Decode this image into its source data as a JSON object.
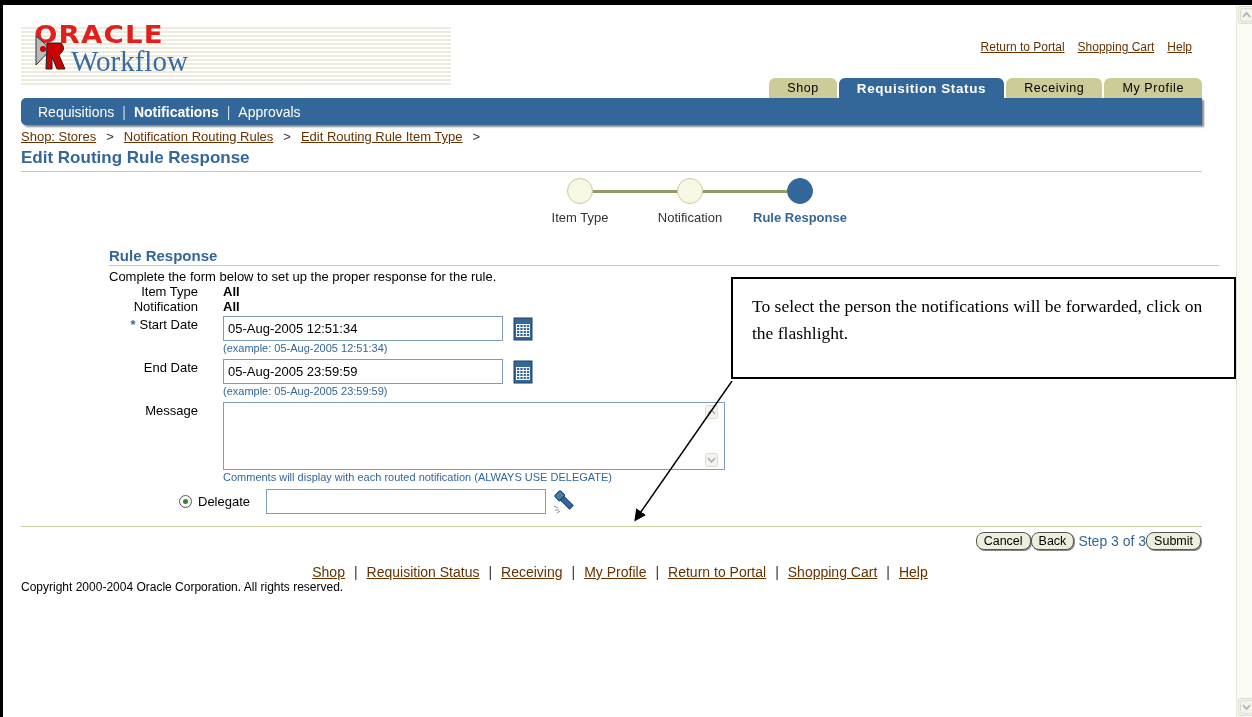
{
  "logo": {
    "brand": "ORACLE",
    "product": "Workflow"
  },
  "global_links": [
    "Return to Portal",
    "Shopping Cart",
    "Help"
  ],
  "tabs": [
    {
      "label": "Shop",
      "selected": false
    },
    {
      "label": "Requisition Status",
      "selected": true
    },
    {
      "label": "Receiving",
      "selected": false
    },
    {
      "label": "My Profile",
      "selected": false
    }
  ],
  "subtabs": [
    {
      "label": "Requisitions",
      "selected": false
    },
    {
      "label": "Notifications",
      "selected": true
    },
    {
      "label": "Approvals",
      "selected": false
    }
  ],
  "breadcrumbs": [
    "Shop: Stores",
    "Notification Routing Rules",
    "Edit Routing Rule Item Type"
  ],
  "breadcrumb_separator": ">",
  "page_title": "Edit Routing Rule Response",
  "train": [
    {
      "label": "Item Type",
      "selected": false
    },
    {
      "label": "Notification",
      "selected": false
    },
    {
      "label": "Rule Response",
      "selected": true
    }
  ],
  "section": {
    "title": "Rule Response",
    "instructions": "Complete the form below to set up the proper response for the rule."
  },
  "fields": [
    {
      "kind": "readonly",
      "label": "Item Type",
      "value": "All"
    },
    {
      "kind": "readonly",
      "label": "Notification",
      "value": "All"
    },
    {
      "kind": "date",
      "label": "Start Date",
      "required": true,
      "value": "05-Aug-2005 12:51:34",
      "hint": "(example: 05-Aug-2005 12:51:34)"
    },
    {
      "kind": "date",
      "label": "End Date",
      "required": false,
      "value": "05-Aug-2005 23:59:59",
      "hint": "(example: 05-Aug-2005 23:59:59)"
    },
    {
      "kind": "textarea",
      "label": "Message",
      "hint": "Comments will display with each routed notification (ALWAYS USE DELEGATE)"
    }
  ],
  "delegate": {
    "label": "Delegate",
    "selected": true
  },
  "required_mark": "*",
  "buttons": {
    "cancel": "Cancel",
    "back": "Back",
    "step": "Step 3 of 3",
    "submit": "Submit"
  },
  "footer_links": [
    "Shop",
    "Requisition Status",
    "Receiving",
    "My Profile",
    "Return to Portal",
    "Shopping Cart",
    "Help"
  ],
  "footer_separator": "|",
  "subtab_separator": "|",
  "copyright": "Copyright 2000-2004 Oracle Corporation. All rights reserved.",
  "callout": "To select the person the notifications will be forwarded, click on the flashlight."
}
